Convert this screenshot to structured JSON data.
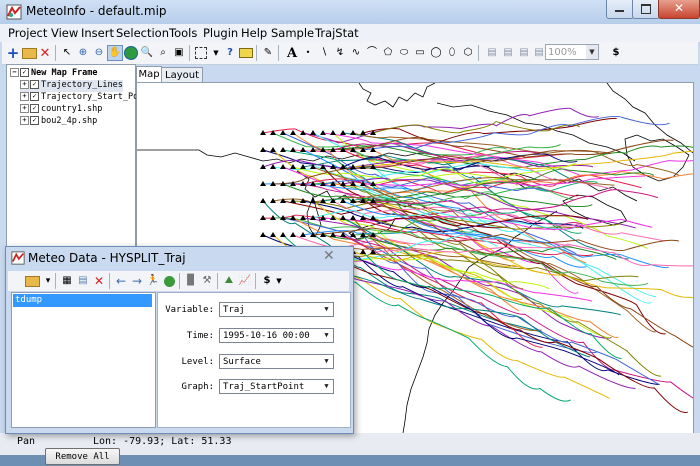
{
  "window": {
    "title": "MeteoInfo - default.mip"
  },
  "menu": [
    "Project",
    "View",
    "Insert",
    "Selection",
    "Tools",
    "Plugin",
    "Help",
    "Sample",
    "TrajStat"
  ],
  "toolbar": {
    "zoom_value": "100%"
  },
  "legend": {
    "frame_label": "New Map Frame",
    "layers": [
      {
        "name": "Trajectory_Lines"
      },
      {
        "name": "Trajectory_Start_Po"
      },
      {
        "name": "country1.shp"
      },
      {
        "name": "bou2_4p.shp"
      }
    ]
  },
  "tabs": [
    {
      "label": "Map"
    },
    {
      "label": "Layout"
    }
  ],
  "status": {
    "mode": "Pan",
    "coords": "Lon: -79.93; Lat: 51.33"
  },
  "dialog": {
    "title": "Meteo Data - HYSPLIT_Traj",
    "files": [
      "tdump"
    ],
    "remove_all_label": "Remove All",
    "fields": [
      {
        "label": "Variable:",
        "value": "Traj"
      },
      {
        "label": "Time:",
        "value": "1995-10-16 00:00"
      },
      {
        "label": "Level:",
        "value": "Surface"
      },
      {
        "label": "Graph:",
        "value": "Traj_StartPoint"
      }
    ]
  },
  "colors": {
    "selection": "#3399ff",
    "titlebar": "#c9daf0",
    "close_button": "#c8442f"
  }
}
